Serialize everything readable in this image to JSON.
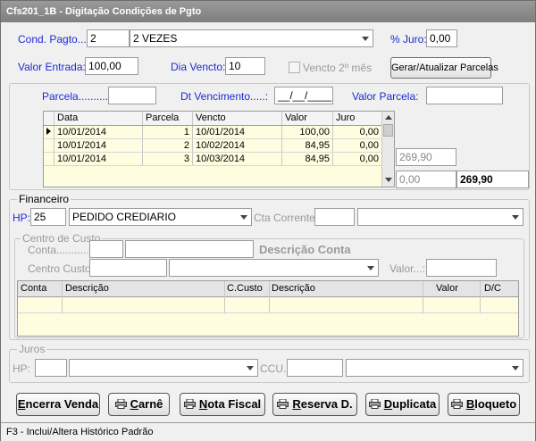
{
  "window": {
    "title": "Cfs201_1B - Digitação Condições de Pgto"
  },
  "cond": {
    "cond_pagto_label": "Cond. Pagto...:",
    "cond_pagto_code": "2",
    "cond_pagto_desc": "2 VEZES",
    "juro_label": "% Juro:",
    "juro_value": "0,00",
    "valor_entrada_label": "Valor Entrada:",
    "valor_entrada_value": "100,00",
    "dia_vencto_label": "Dia Vencto:",
    "dia_vencto_value": "10",
    "vencto_2_mes_label": "Vencto 2º mês",
    "gerar_button": "Gerar/Atualizar Parcelas"
  },
  "parcela_form": {
    "parcela_label": "Parcela..........:",
    "parcela_value": "",
    "dt_vencimento_label": "Dt Vencimento.....:",
    "dt_vencimento_value": "__/__/____",
    "valor_parcela_label": "Valor Parcela:",
    "valor_parcela_value": ""
  },
  "parcelas_grid": {
    "columns": [
      "Data",
      "Parcela",
      "Vencto",
      "Valor",
      "Juro"
    ],
    "rows": [
      {
        "data": "10/01/2014",
        "parcela": "1",
        "vencto": "10/01/2014",
        "valor": "100,00",
        "juro": "0,00"
      },
      {
        "data": "10/01/2014",
        "parcela": "2",
        "vencto": "10/02/2014",
        "valor": "84,95",
        "juro": "0,00"
      },
      {
        "data": "10/01/2014",
        "parcela": "3",
        "vencto": "10/03/2014",
        "valor": "84,95",
        "juro": "0,00"
      }
    ]
  },
  "totals": {
    "subtotal": "269,90",
    "juro_total": "0,00",
    "total": "269,90"
  },
  "financeiro": {
    "title": "Financeiro",
    "hp_label": "HP:",
    "hp_code": "25",
    "hp_desc": "PEDIDO CREDIARIO",
    "cta_corrente_label": "Cta Corrente:",
    "cta_corrente_code": "",
    "cta_corrente_desc": ""
  },
  "centro_custo": {
    "title": "Centro de Custo",
    "conta_label": "Conta..............:",
    "conta_code": "",
    "conta_desc": "",
    "descricao_conta_label": "Descrição Conta",
    "centro_custo_label": "Centro Custo:",
    "centro_custo_code": "",
    "centro_custo_desc": "",
    "valor_label": "Valor...:",
    "valor_value": "",
    "grid_columns": [
      "Conta",
      "Descrição",
      "C.Custo",
      "Descrição",
      "Valor",
      "D/C"
    ]
  },
  "juros": {
    "title": "Juros",
    "hp_label": "HP:",
    "hp_code": "",
    "hp_desc": "",
    "ccu_label": "CCU.:",
    "ccu_code": "",
    "ccu_desc": ""
  },
  "buttons": {
    "encerra_venda_u": "E",
    "encerra_venda_rest": "ncerra Venda",
    "carne_u": "C",
    "carne_rest": "arnê",
    "nota_fiscal_u": "N",
    "nota_fiscal_rest": "ota Fiscal",
    "reserva_u": "R",
    "reserva_rest": "eserva D.",
    "duplicata_u": "D",
    "duplicata_rest": "uplicata",
    "bloqueto_u": "B",
    "bloqueto_rest": "loqueto"
  },
  "status": {
    "text": "F3 - Inclui/Altera Histórico Padrão"
  }
}
